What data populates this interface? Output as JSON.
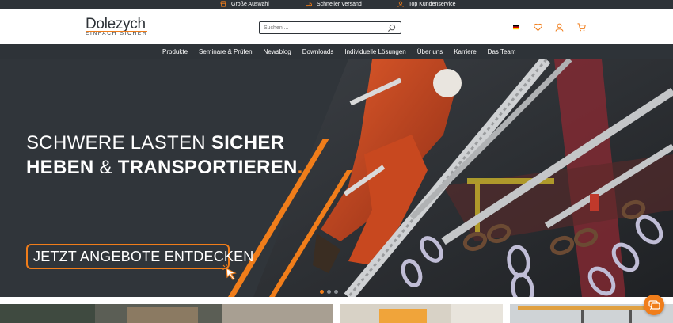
{
  "topbar": {
    "usps": [
      {
        "label": "Große Auswahl",
        "icon": "storefront-icon"
      },
      {
        "label": "Schneller Versand",
        "icon": "delivery-truck-icon"
      },
      {
        "label": "Top Kundenservice",
        "icon": "support-agent-icon"
      }
    ]
  },
  "header": {
    "logo": {
      "brand": "Dolezych",
      "tagline": "EINFACH SICHER"
    },
    "search": {
      "placeholder": "Suchen ...",
      "value": ""
    },
    "icons": [
      "german-flag-icon",
      "heart-icon",
      "user-icon",
      "cart-icon"
    ]
  },
  "nav": {
    "items": [
      "Produkte",
      "Seminare & Prüfen",
      "Newsblog",
      "Downloads",
      "Individuelle Lösungen",
      "Über uns",
      "Karriere",
      "Das Team"
    ]
  },
  "hero": {
    "title_line1_light": "SCHWERE LASTEN ",
    "title_line1_bold": "SICHER",
    "title_line2_bold1": "HEBEN",
    "title_line2_light": " & ",
    "title_line2_bold2": "TRANSPORTIEREN",
    "title_dot": ".",
    "cta_label": "JETZT ANGEBOTE ENTDECKEN",
    "slider": {
      "total": 3,
      "active": 1
    }
  },
  "colors": {
    "accent": "#f07d1a",
    "dark": "#2e3338",
    "hero_bg": "#30353a",
    "white": "#ffffff"
  },
  "chat": {
    "icon": "chat-bubble-icon"
  }
}
